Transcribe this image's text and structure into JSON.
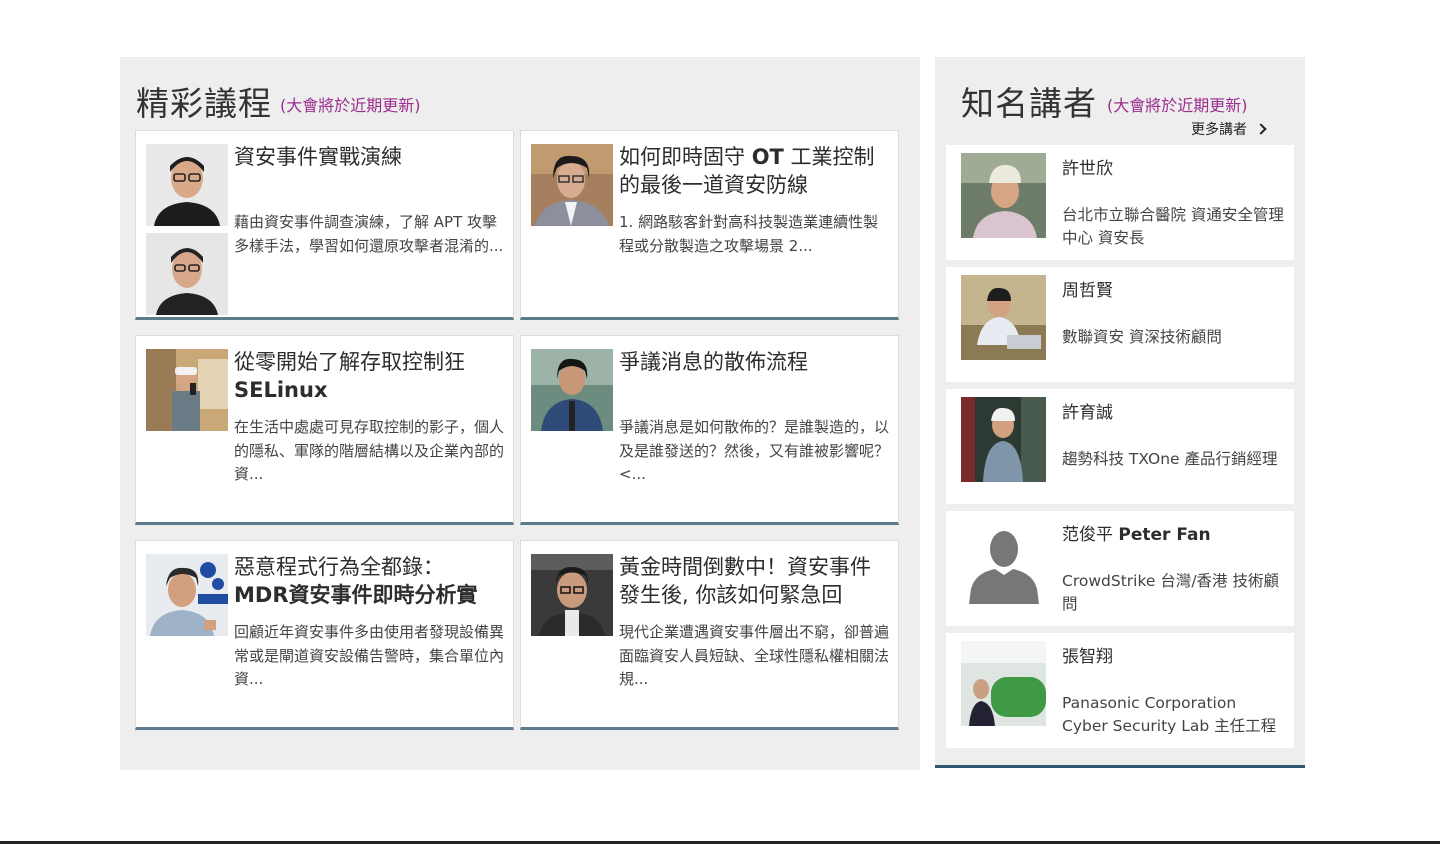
{
  "sessions": {
    "title": "精彩議程",
    "note": "(大會將於近期更新)",
    "cards": [
      {
        "title": "資安事件實戰演練",
        "desc": "藉由資安事件調查演練，了解 APT 攻擊多樣手法，學習如何還原攻擊者混淆的..."
      },
      {
        "title_a": "如何即時固守 ",
        "title_b": "OT",
        "title_c": " 工業控制的最後一道資安防線",
        "desc": "1. 網路駭客針對高科技製造業連續性製程或分散製造之攻擊場景 2..."
      },
      {
        "title_a": "從零開始了解存取控制狂 ",
        "title_b": "SELinux",
        "desc": "在生活中處處可見存取控制的影子，個人的隱私、軍隊的階層結構以及企業內部的資..."
      },
      {
        "title": "爭議消息的散佈流程",
        "desc": "爭議消息是如何散佈的？是誰製造的，以及是誰發送的？然後，又有誰被影響呢？<..."
      },
      {
        "title_a": "惡意程式行為全都錄：",
        "title_b": "MDR",
        "title_c": "資安事件即時分析實",
        "desc": "回顧近年資安事件多由使用者發現設備異常或是閘道資安設備告警時，集合單位內資..."
      },
      {
        "title_a": "黃金時間倒數中！資安事件發生後",
        "title_b": ", ",
        "title_c": "你該如何緊急回",
        "desc": "現代企業遭遇資安事件層出不窮，卻普遍面臨資安人員短缺、全球性隱私權相關法規..."
      }
    ]
  },
  "speakers": {
    "title": "知名講者",
    "note": "(大會將於近期更新)",
    "more_label": "更多講者",
    "items": [
      {
        "name": "許世欣",
        "title": "台北市立聯合醫院 資通安全管理中心 資安長"
      },
      {
        "name": "周哲賢",
        "title": "數聯資安 資深技術顧問"
      },
      {
        "name": "許育誠",
        "title": "趨勢科技 TXOne 產品行銷經理"
      },
      {
        "name_a": "范俊平 ",
        "name_b": "Peter Fan",
        "title": "CrowdStrike 台灣/香港 技術顧問"
      },
      {
        "name": "張智翔",
        "title": "Panasonic Corporation Cyber Security Lab 主任工程"
      }
    ]
  },
  "colors": {
    "accent": "#9b2e8e",
    "card_border": "#5d7b8c",
    "speaker_border": "#2e5670",
    "panel_bg": "#eeeeee"
  },
  "icons": {
    "more": "chevron-right-icon",
    "placeholder": "person-silhouette-icon"
  }
}
